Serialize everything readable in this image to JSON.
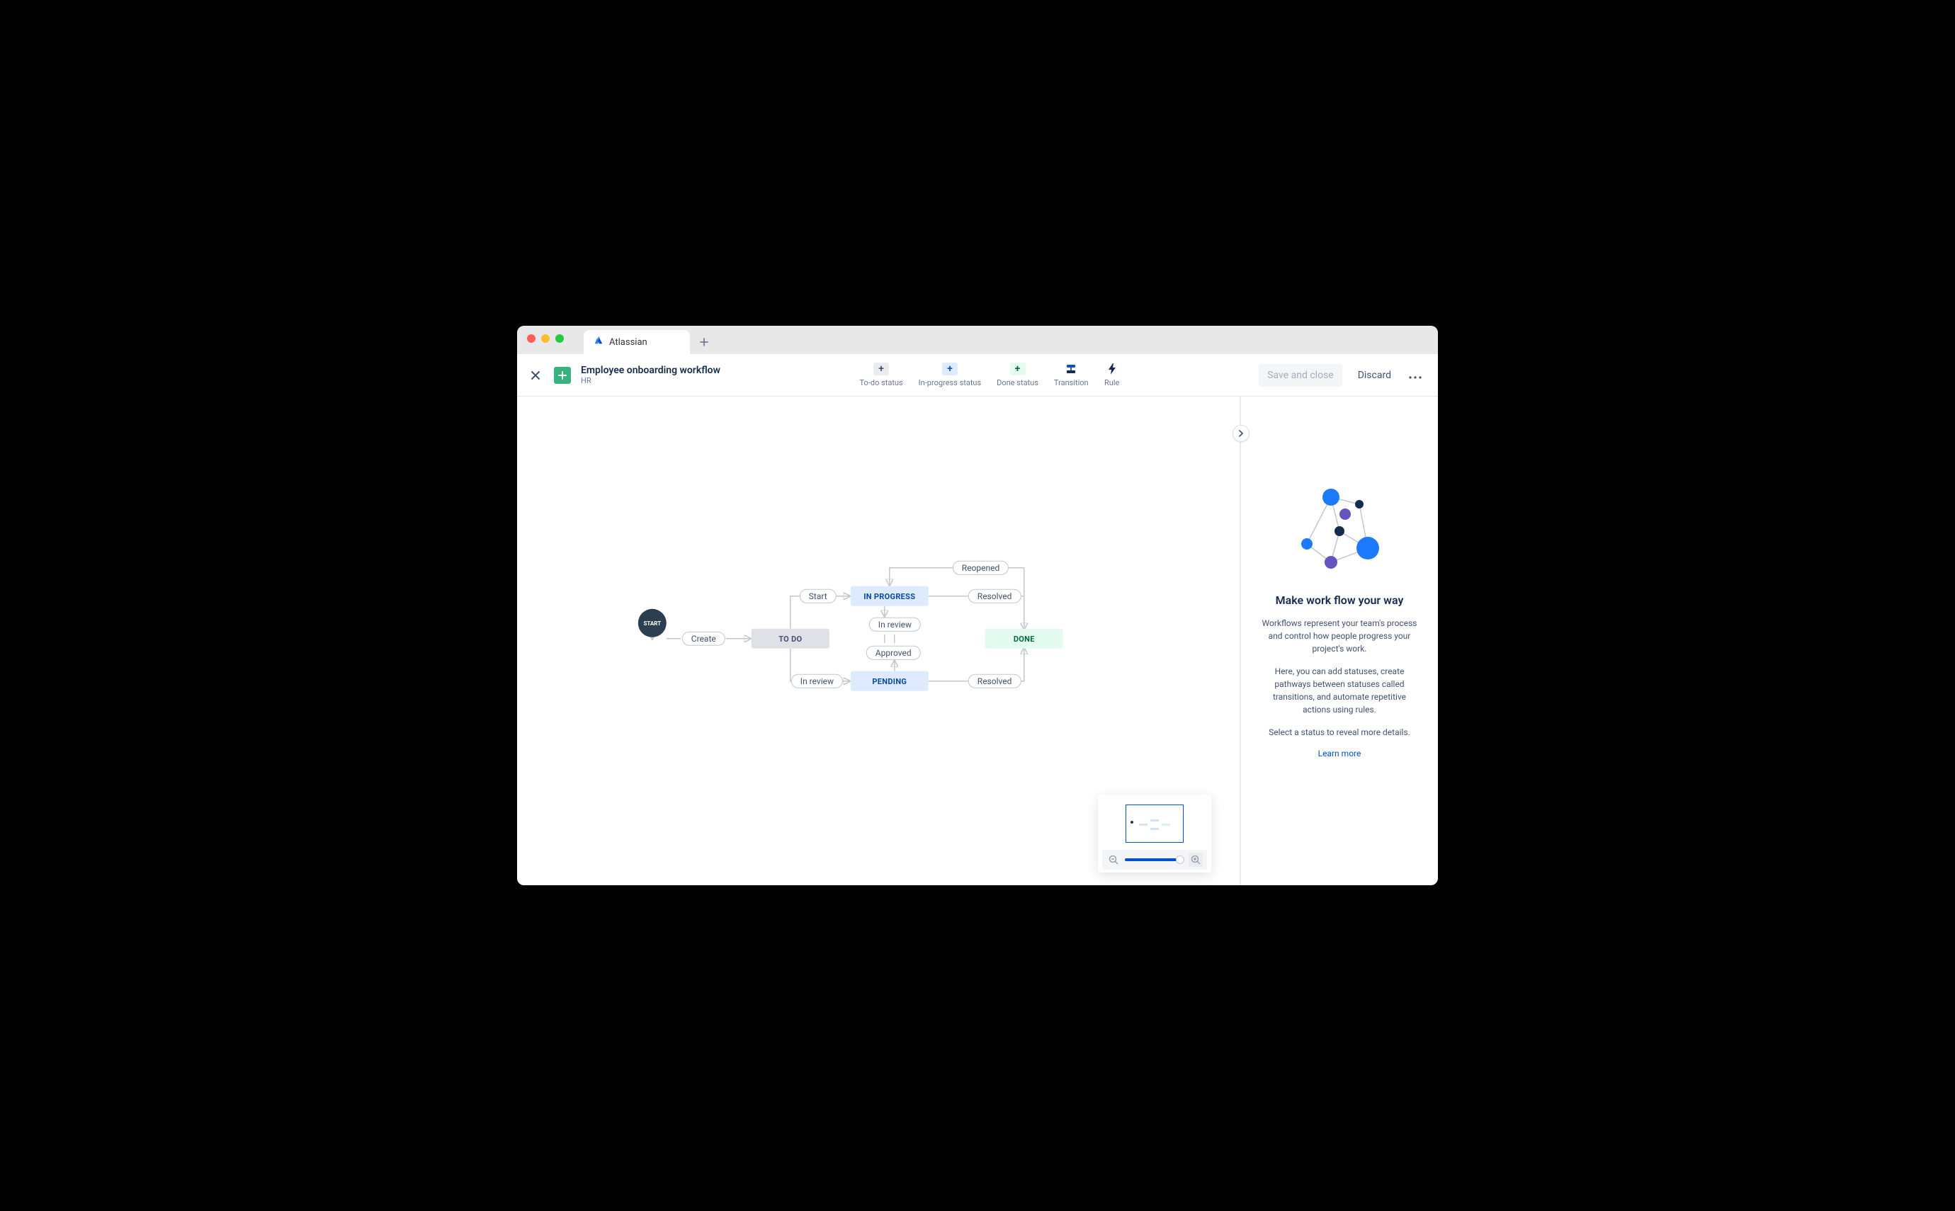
{
  "browser": {
    "tab_title": "Atlassian"
  },
  "header": {
    "workflow_title": "Employee onboarding workflow",
    "project_key": "HR",
    "tools": {
      "todo": "To-do status",
      "inprog": "In-progress status",
      "done": "Done status",
      "transition": "Transition",
      "rule": "Rule"
    },
    "save_label": "Save and close",
    "discard_label": "Discard"
  },
  "workflow": {
    "start_label": "START",
    "statuses": {
      "todo": "TO DO",
      "inprog": "IN PROGRESS",
      "pending": "PENDING",
      "done": "DONE"
    },
    "transitions": {
      "create": "Create",
      "start": "Start",
      "in_review_top": "In review",
      "in_review_btm": "In review",
      "approved": "Approved",
      "resolved_top": "Resolved",
      "resolved_btm": "Resolved",
      "reopened": "Reopened"
    }
  },
  "side": {
    "title": "Make work flow your way",
    "p1": "Workflows represent your team's process and control how people progress your project's work.",
    "p2": "Here, you can add statuses, create pathways between statuses called transitions, and automate repetitive actions using rules.",
    "p3": "Select a status to reveal more details.",
    "learn_more": "Learn more"
  },
  "colors": {
    "blue_primary": "#0052cc",
    "blue_bg": "#deebff",
    "green_bg": "#e3fcef",
    "grey_bg": "#dfe1e6",
    "text": "#172b4d",
    "subtle": "#6b778c"
  }
}
